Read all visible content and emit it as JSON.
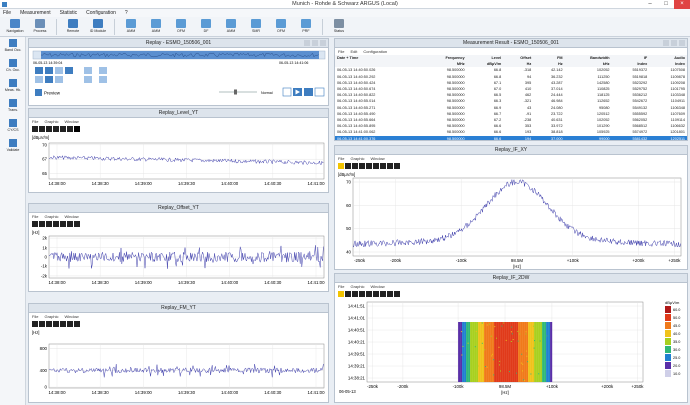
{
  "window": {
    "title": "Munich - Rohde & Schwarz ARGUS (Local)"
  },
  "menu": [
    "File",
    "Measurement",
    "Statistic",
    "Configuration",
    "?"
  ],
  "ribbon": [
    {
      "label": "Navigation",
      "color": "#4a86c8"
    },
    {
      "label": "Process",
      "color": "#6b8fb8"
    },
    {
      "label": "Remote",
      "color": "#3e7dc0"
    },
    {
      "label": "ID Module",
      "color": "#3e7dc0"
    },
    {
      "label": "AMM",
      "color": "#5b9bd5"
    },
    {
      "label": "AMM",
      "color": "#5b9bd5"
    },
    {
      "label": "OFM",
      "color": "#5b9bd5"
    },
    {
      "label": "DF",
      "color": "#5b9bd5"
    },
    {
      "label": "AMM",
      "color": "#5b9bd5"
    },
    {
      "label": "SMR",
      "color": "#5b9bd5"
    },
    {
      "label": "OFM",
      "color": "#5b9bd5"
    },
    {
      "label": "PRF",
      "color": "#5b9bd5"
    },
    {
      "label": "Status",
      "color": "#7d8fa3"
    }
  ],
  "sidebar": [
    "Band Occ.",
    "Ch. Occ.",
    "Meas. Hk.",
    "Trans.",
    "CY/CS",
    "Validate"
  ],
  "replay": {
    "title": "Replay - ESMO_150506_001",
    "time_left": "06-05-13 14:39:04",
    "time_right": "06-05-13 14:41:06",
    "preview": "Preview",
    "speed": "Normal"
  },
  "level": {
    "title": "Replay_Level_YT",
    "unit": "[dBµV/m]",
    "yticks": [
      "70",
      "67",
      "65"
    ],
    "xticks": [
      "14:38:00",
      "14:38:30",
      "14:39:00",
      "14:39:30",
      "14:40:00",
      "14:40:30",
      "14:41:00"
    ]
  },
  "offset": {
    "title": "Replay_Offset_YT",
    "unit": "[Hz]",
    "yticks": [
      "2k",
      "1k",
      "0",
      "-1k",
      "-2k"
    ],
    "xticks": [
      "14:38:00",
      "14:38:30",
      "14:39:00",
      "14:39:30",
      "14:40:00",
      "14:40:30",
      "14:41:00"
    ]
  },
  "fm": {
    "title": "Replay_FM_YT",
    "unit": "[Hz]",
    "yticks": [
      "800",
      "400",
      "0"
    ],
    "xticks": [
      "14:38:00",
      "14:38:30",
      "14:39:00",
      "14:39:30",
      "14:40:00",
      "14:40:30",
      "14:41:00"
    ]
  },
  "result": {
    "title": "Measurement Result - ESMO_150506_001",
    "menu": [
      "File",
      "Edit",
      "Configuration"
    ],
    "headers": [
      "Date + Time",
      "Frequency",
      "Level",
      "Offset",
      "FM",
      "Bandwidth",
      "IF",
      "Audio"
    ],
    "units": [
      "",
      "MHz",
      "dBµV/m",
      "Hz",
      "Hz",
      "kHz",
      "Index",
      "Index"
    ],
    "rows": [
      [
        "06-05-13 14:40:50.026",
        "98.500000",
        "66.8",
        "-318",
        "42.142",
        "102052",
        "5519372",
        "1107508"
      ],
      [
        "06-05-13 14:40:50.292",
        "98.500000",
        "66.8",
        "94",
        "36.232",
        "111250",
        "5519818",
        "1109878"
      ],
      [
        "06-05-13 14:40:50.424",
        "98.500000",
        "67.1",
        "395",
        "43.287",
        "142580",
        "5523292",
        "1109208"
      ],
      [
        "06-05-13 14:40:50.674",
        "98.500000",
        "67.0",
        "410",
        "37.014",
        "110825",
        "5529752",
        "1101795"
      ],
      [
        "06-05-13 14:40:50.822",
        "98.500000",
        "66.5",
        "462",
        "24.444",
        "118125",
        "5536212",
        "1103348"
      ],
      [
        "06-05-13 14:40:55.014",
        "98.500000",
        "66.3",
        "-321",
        "46.984",
        "112652",
        "5542672",
        "1104911"
      ],
      [
        "06-05-13 14:40:55.271",
        "98.500000",
        "66.9",
        "43",
        "24.080",
        "95080",
        "5549132",
        "1106348"
      ],
      [
        "06-05-13 14:40:55.490",
        "98.500000",
        "66.7",
        "-91",
        "23.722",
        "120512",
        "5555592",
        "1107609"
      ],
      [
        "06-05-13 14:40:55.664",
        "98.500000",
        "67.2",
        "-238",
        "40.631",
        "102052",
        "5562052",
        "1109114"
      ],
      [
        "06-05-13 14:40:55.895",
        "98.500000",
        "66.6",
        "353",
        "33.972",
        "101290",
        "5568512",
        "1106632"
      ],
      [
        "06-05-13 14:41:00.062",
        "98.500000",
        "66.6",
        "193",
        "38.818",
        "105925",
        "5574972",
        "1201801"
      ],
      [
        "06-05-13 14:41:00.376",
        "98.500000",
        "66.6",
        "194",
        "37.000",
        "99000",
        "5581432",
        "1202511"
      ],
      [
        "06-05-13 14:41:00.461",
        "98.500000",
        "66.6",
        "462",
        "51.081",
        "112802",
        "5587892",
        "1204112"
      ]
    ],
    "selected": 11
  },
  "ifxy": {
    "title": "Replay_IF_XY",
    "unit": "[dBµV/m]",
    "yticks": [
      "70",
      "60",
      "50",
      "40"
    ],
    "xticks": [
      "-250k",
      "-200k",
      "-100k",
      "98.5M",
      "+100k",
      "+200k",
      "+250k"
    ],
    "xunit": "[Hz]"
  },
  "if2dw": {
    "title": "Replay_IF_2DW",
    "yticks": [
      "14:41:51",
      "14:41:01",
      "14:40:51",
      "14:40:21",
      "14:39:51",
      "14:39:21",
      "14:38:21"
    ],
    "xticks": [
      "-250k",
      "-200k",
      "-100k",
      "98.5M",
      "+100k",
      "+200k",
      "+250k"
    ],
    "date": "06-05-13",
    "xunit": "[Hz]",
    "legend_unit": "dBµV/m",
    "legend": [
      {
        "v": "60.0",
        "c": "#b01818"
      },
      {
        "v": "50.0",
        "c": "#e03a1a"
      },
      {
        "v": "45.0",
        "c": "#f07a1a"
      },
      {
        "v": "40.0",
        "c": "#f0c21a"
      },
      {
        "v": "35.0",
        "c": "#a8d020"
      },
      {
        "v": "30.0",
        "c": "#30b878"
      },
      {
        "v": "25.0",
        "c": "#2080d0"
      },
      {
        "v": "20.0",
        "c": "#5a2fa8"
      },
      {
        "v": "10.0",
        "c": "#cfcfe8"
      }
    ]
  }
}
